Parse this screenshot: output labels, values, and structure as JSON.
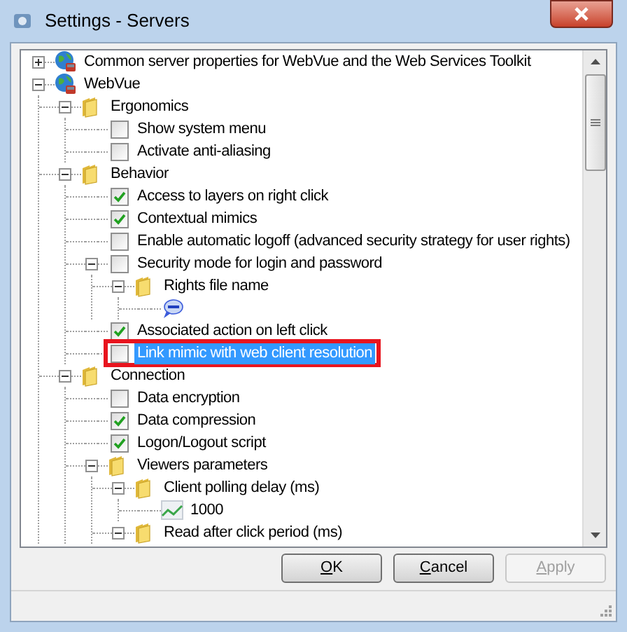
{
  "window": {
    "title": "Settings - Servers"
  },
  "tree": [
    {
      "kind": "server",
      "label": "Common server properties for WebVue and the Web Services Toolkit",
      "expanded": false,
      "selected": false
    },
    {
      "kind": "server",
      "label": "WebVue",
      "expanded": true,
      "selected": false,
      "children": [
        {
          "kind": "folder",
          "label": "Ergonomics",
          "expanded": true,
          "selected": false,
          "children": [
            {
              "kind": "checkbox",
              "label": "Show system menu",
              "checked": false,
              "selected": false
            },
            {
              "kind": "checkbox",
              "label": "Activate anti-aliasing",
              "checked": false,
              "selected": false
            }
          ]
        },
        {
          "kind": "folder",
          "label": "Behavior",
          "expanded": true,
          "selected": false,
          "children": [
            {
              "kind": "checkbox",
              "label": "Access to layers on right click",
              "checked": true,
              "selected": false
            },
            {
              "kind": "checkbox",
              "label": "Contextual mimics",
              "checked": true,
              "selected": false
            },
            {
              "kind": "checkbox",
              "label": "Enable automatic logoff (advanced security strategy for user rights)",
              "checked": false,
              "selected": false
            },
            {
              "kind": "checkbox",
              "label": "Security mode for login and password",
              "checked": false,
              "expanded": true,
              "selected": false,
              "children": [
                {
                  "kind": "folder",
                  "label": "Rights file name",
                  "expanded": true,
                  "selected": false,
                  "children": [
                    {
                      "kind": "string",
                      "selected": false
                    }
                  ]
                }
              ]
            },
            {
              "kind": "checkbox",
              "label": "Associated action on left click",
              "checked": true,
              "selected": false
            },
            {
              "kind": "checkbox",
              "label": "Link mimic with web client resolution",
              "checked": false,
              "selected": true,
              "outlined": true
            }
          ]
        },
        {
          "kind": "folder",
          "label": "Connection",
          "expanded": true,
          "selected": false,
          "children": [
            {
              "kind": "checkbox",
              "label": "Data encryption",
              "checked": false,
              "selected": false
            },
            {
              "kind": "checkbox",
              "label": "Data compression",
              "checked": true,
              "selected": false
            },
            {
              "kind": "checkbox",
              "label": "Logon/Logout script",
              "checked": true,
              "selected": false
            },
            {
              "kind": "folder",
              "label": "Viewers parameters",
              "expanded": true,
              "selected": false,
              "children": [
                {
                  "kind": "folder",
                  "label": "Client polling delay (ms)",
                  "expanded": true,
                  "selected": false,
                  "children": [
                    {
                      "kind": "number",
                      "label": "1000",
                      "selected": false
                    }
                  ]
                },
                {
                  "kind": "folder",
                  "label": "Read after click period (ms)",
                  "expanded": true,
                  "selected": false
                }
              ]
            }
          ]
        }
      ]
    }
  ],
  "buttons": [
    {
      "label": "OK",
      "disabled": false
    },
    {
      "label": "Cancel",
      "disabled": false
    },
    {
      "label": "Apply",
      "disabled": true
    }
  ]
}
